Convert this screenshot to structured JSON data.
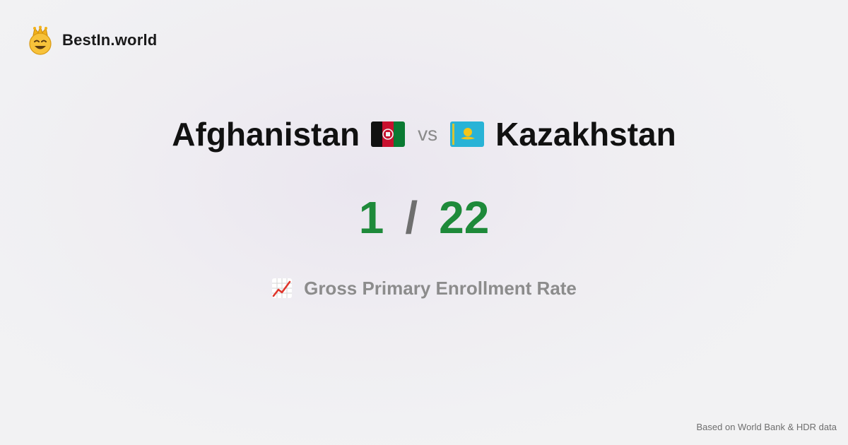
{
  "brand": {
    "name": "BestIn.world",
    "logo_icon": "crowned-smiley-face-icon"
  },
  "comparison": {
    "left_country": "Afghanistan",
    "left_flag_icon": "afghanistan-flag-icon",
    "vs_label": "vs",
    "right_country": "Kazakhstan",
    "right_flag_icon": "kazakhstan-flag-icon"
  },
  "scores": {
    "left_rank": "1",
    "separator": "/",
    "right_rank": "22",
    "rank_color": "#1e8a3a"
  },
  "metric": {
    "icon": "chart-increasing-icon",
    "label": "Gross Primary Enrollment Rate"
  },
  "footer": {
    "source_note": "Based on World Bank & HDR data"
  }
}
